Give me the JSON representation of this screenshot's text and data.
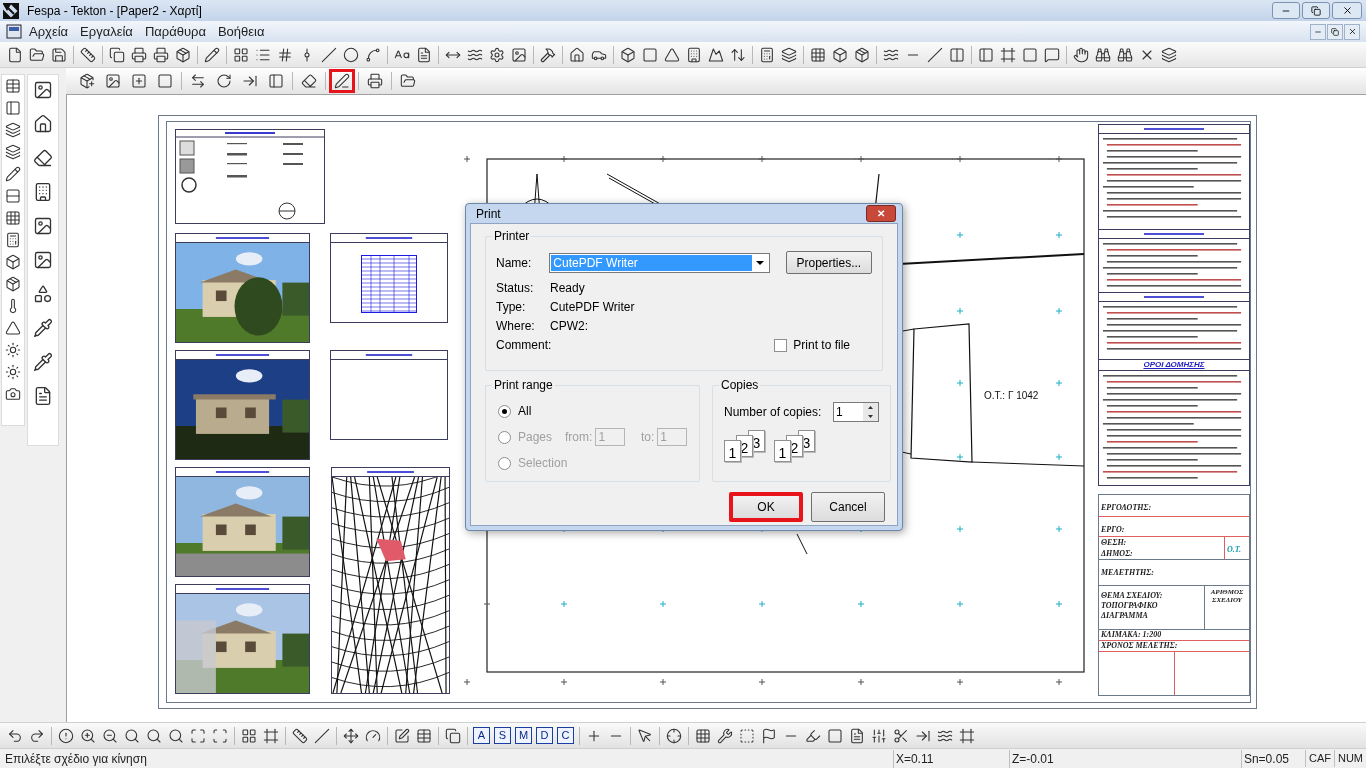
{
  "window": {
    "title": "Fespa - Tekton - [Paper2 - Χαρτί]"
  },
  "menu": [
    "Αρχεία",
    "Εργαλεία",
    "Παράθυρα",
    "Βοήθεια"
  ],
  "secondary_toolbar": [
    {
      "highlighted": false
    },
    {
      "highlighted": false
    },
    {
      "highlighted": false
    },
    {
      "highlighted": false
    },
    {
      "highlighted": false
    },
    {
      "highlighted": false
    },
    {
      "highlighted": false
    },
    {
      "highlighted": false
    },
    {
      "highlighted": false
    },
    {
      "highlighted": true
    },
    {
      "highlighted": false
    },
    {
      "highlighted": false
    }
  ],
  "drawing": {
    "lot_label": "Ο.Τ.: Γ 1042",
    "building_terms_heading": "ΟΡΟΙ ΔΟΜΗΣΗΣ",
    "title_block": {
      "contractor": "ΕΡΓΟΛΟΤΗΣ:",
      "project": "ΕΡΓΟ:",
      "location": "ΘΕΣΗ:",
      "municipality": "ΔΗΜΟΣ:",
      "block": "Ο.Τ.",
      "designer": "ΜΕΛΕΤΗΤΗΣ:",
      "subject": "ΘΕΜΑ ΣΧΕΔΙΟΥ: ΤΟΠΟΓΡΑΦΙΚΟ ΔΙΑΓΡΑΜΜΑ",
      "drawing_number": "ΑΡΙΘΜΟΣ ΣΧΕΔΙΟΥ",
      "scale": "ΚΛΙΜΑΚΑ: 1:200",
      "date": "ΧΡΟΝΟΣ ΜΕΛΕΤΗΣ:"
    }
  },
  "print_dialog": {
    "title": "Print",
    "close": "✕",
    "printer": {
      "legend": "Printer",
      "name_label": "Name:",
      "name_value": "CutePDF Writer",
      "properties": "Properties...",
      "info": [
        {
          "label": "Status:",
          "value": "Ready"
        },
        {
          "label": "Type:",
          "value": "CutePDF Writer"
        },
        {
          "label": "Where:",
          "value": "CPW2:"
        },
        {
          "label": "Comment:"
        }
      ],
      "print_to_file": {
        "label": "Print to file",
        "checked": false
      }
    },
    "print_range": {
      "legend": "Print range",
      "options": [
        {
          "label": "All",
          "selected": true,
          "disabled": false
        },
        {
          "label": "Pages",
          "selected": false,
          "disabled": true
        },
        {
          "label": "Selection",
          "selected": false,
          "disabled": true
        }
      ],
      "from_label": "from:",
      "from_value": "1",
      "to_label": "to:",
      "to_value": "1"
    },
    "copies": {
      "legend": "Copies",
      "label": "Number of copies:",
      "value": "1",
      "collate_pages": [
        [
          "1",
          "2",
          "3"
        ],
        [
          "1",
          "2",
          "3"
        ]
      ]
    },
    "buttons": [
      {
        "label": "OK",
        "highlighted": true
      },
      {
        "label": "Cancel",
        "highlighted": false
      }
    ]
  },
  "bottom_toolbar_letters": [
    "A",
    "S",
    "M",
    "D",
    "C"
  ],
  "status_bar": {
    "message": "Επιλέξτε σχέδιο για κίνηση",
    "x": "X=0.11",
    "z": "Z=-0.01",
    "snap": "Sn=0.05",
    "indicators": [
      "CAF",
      "NUM"
    ]
  }
}
